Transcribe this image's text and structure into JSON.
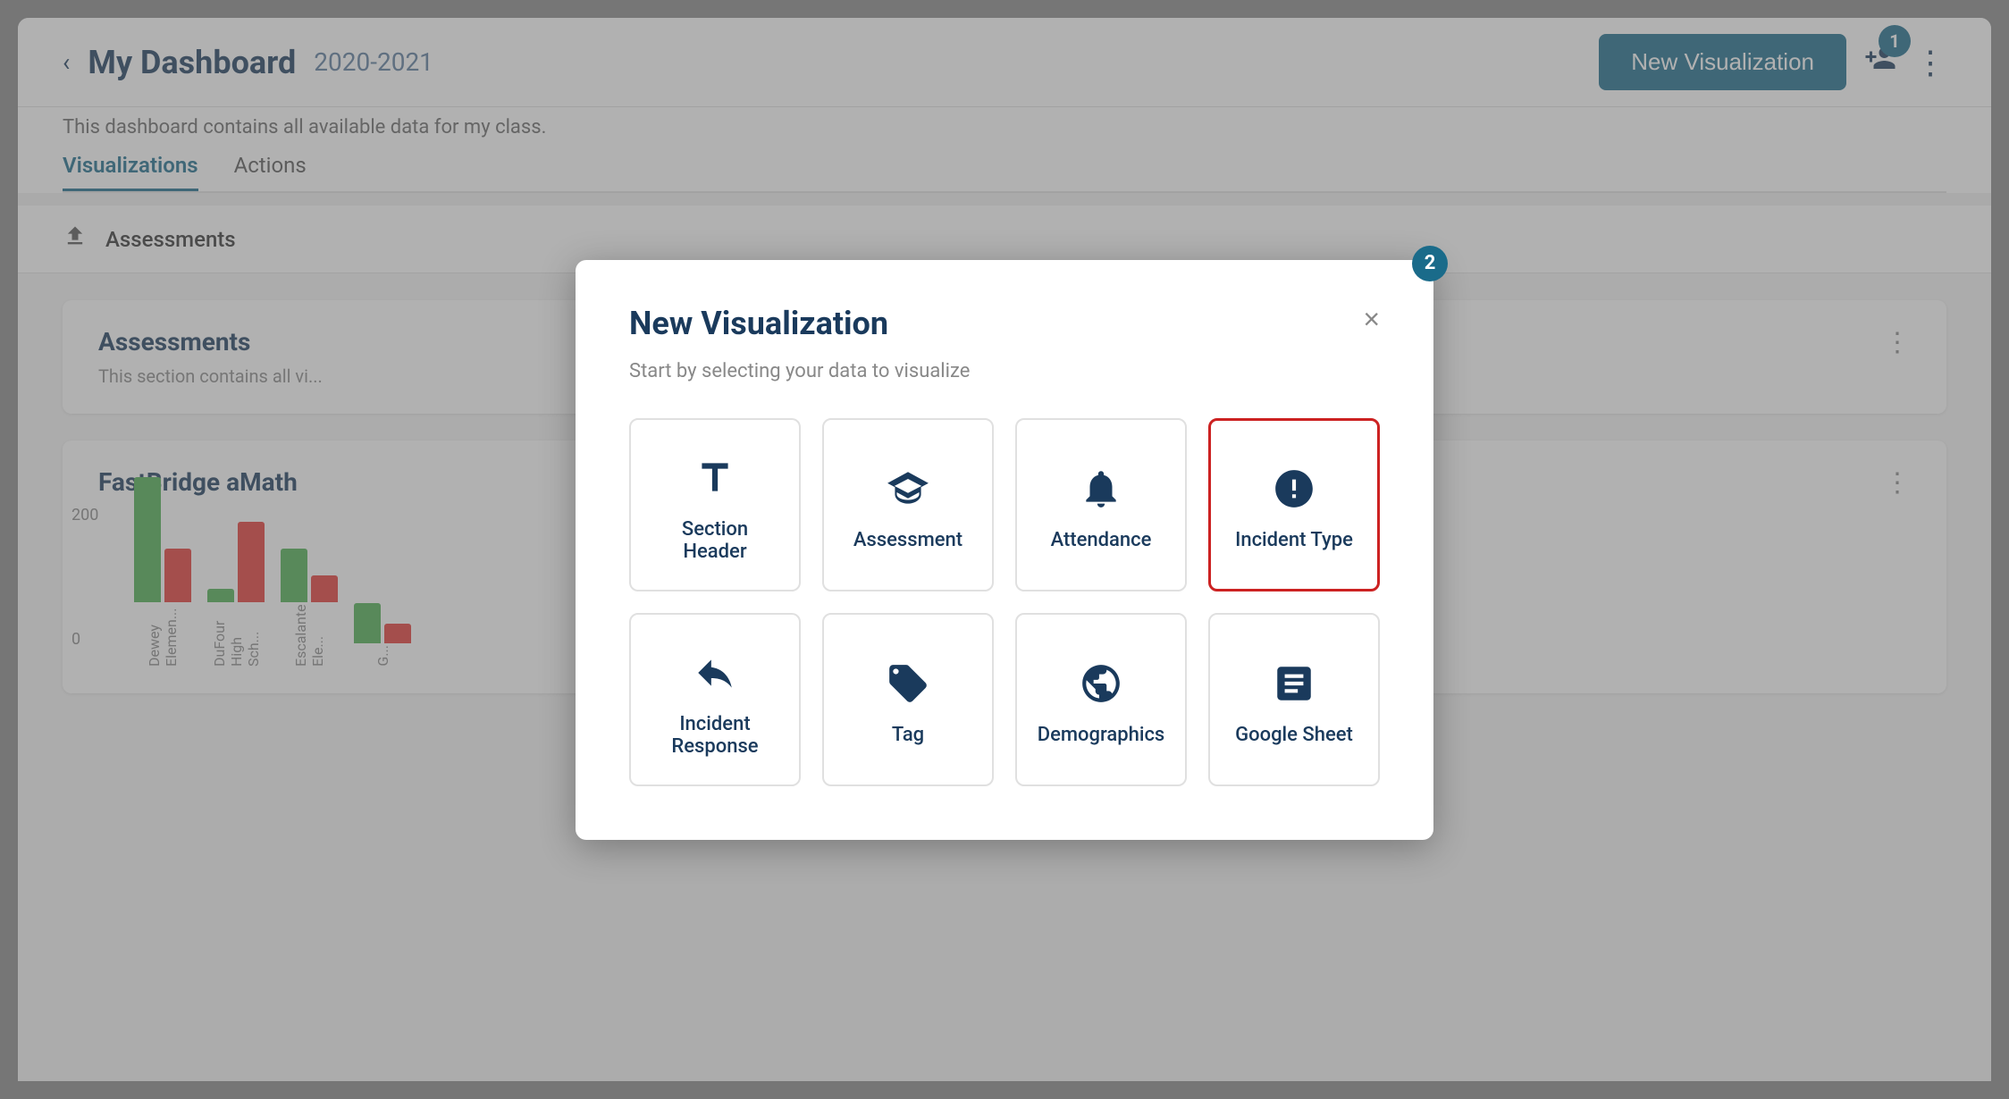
{
  "header": {
    "back_label": "‹",
    "title": "My Dashboard",
    "year": "2020-2021",
    "subtitle": "This dashboard contains all available data for my class.",
    "new_viz_label": "New Visualization",
    "badge1": "1"
  },
  "tabs": [
    {
      "label": "Visualizations",
      "active": true
    },
    {
      "label": "Actions",
      "active": false
    }
  ],
  "filter": {
    "label": "Assessments"
  },
  "cards": [
    {
      "title": "Assessments",
      "subtitle": "This section contains all vi..."
    },
    {
      "title": "FastBridge aMath",
      "subtitle": ""
    }
  ],
  "modal": {
    "title": "New Visualization",
    "subtitle": "Start by selecting your data to visualize",
    "close_label": "×",
    "badge": "2",
    "options": [
      {
        "id": "section-header",
        "label": "Section Header",
        "icon": "text"
      },
      {
        "id": "assessment",
        "label": "Assessment",
        "icon": "graduation"
      },
      {
        "id": "attendance",
        "label": "Attendance",
        "icon": "bell"
      },
      {
        "id": "incident-type",
        "label": "Incident Type",
        "icon": "exclamation",
        "selected": true
      },
      {
        "id": "incident-response",
        "label": "Incident Response",
        "icon": "reply"
      },
      {
        "id": "tag",
        "label": "Tag",
        "icon": "tag"
      },
      {
        "id": "demographics",
        "label": "Demographics",
        "icon": "globe"
      },
      {
        "id": "google-sheet",
        "label": "Google Sheet",
        "icon": "sheet"
      }
    ]
  },
  "chart": {
    "bars": [
      {
        "label": "Dewey Elemen...",
        "green": 180,
        "red": 80
      },
      {
        "label": "DuFour High Sch...",
        "green": 20,
        "red": 120
      },
      {
        "label": "Escalante Ele...",
        "green": 80,
        "red": 40
      },
      {
        "label": "G...",
        "green": 60,
        "red": 30
      }
    ],
    "y_labels": [
      "200",
      "0"
    ]
  }
}
